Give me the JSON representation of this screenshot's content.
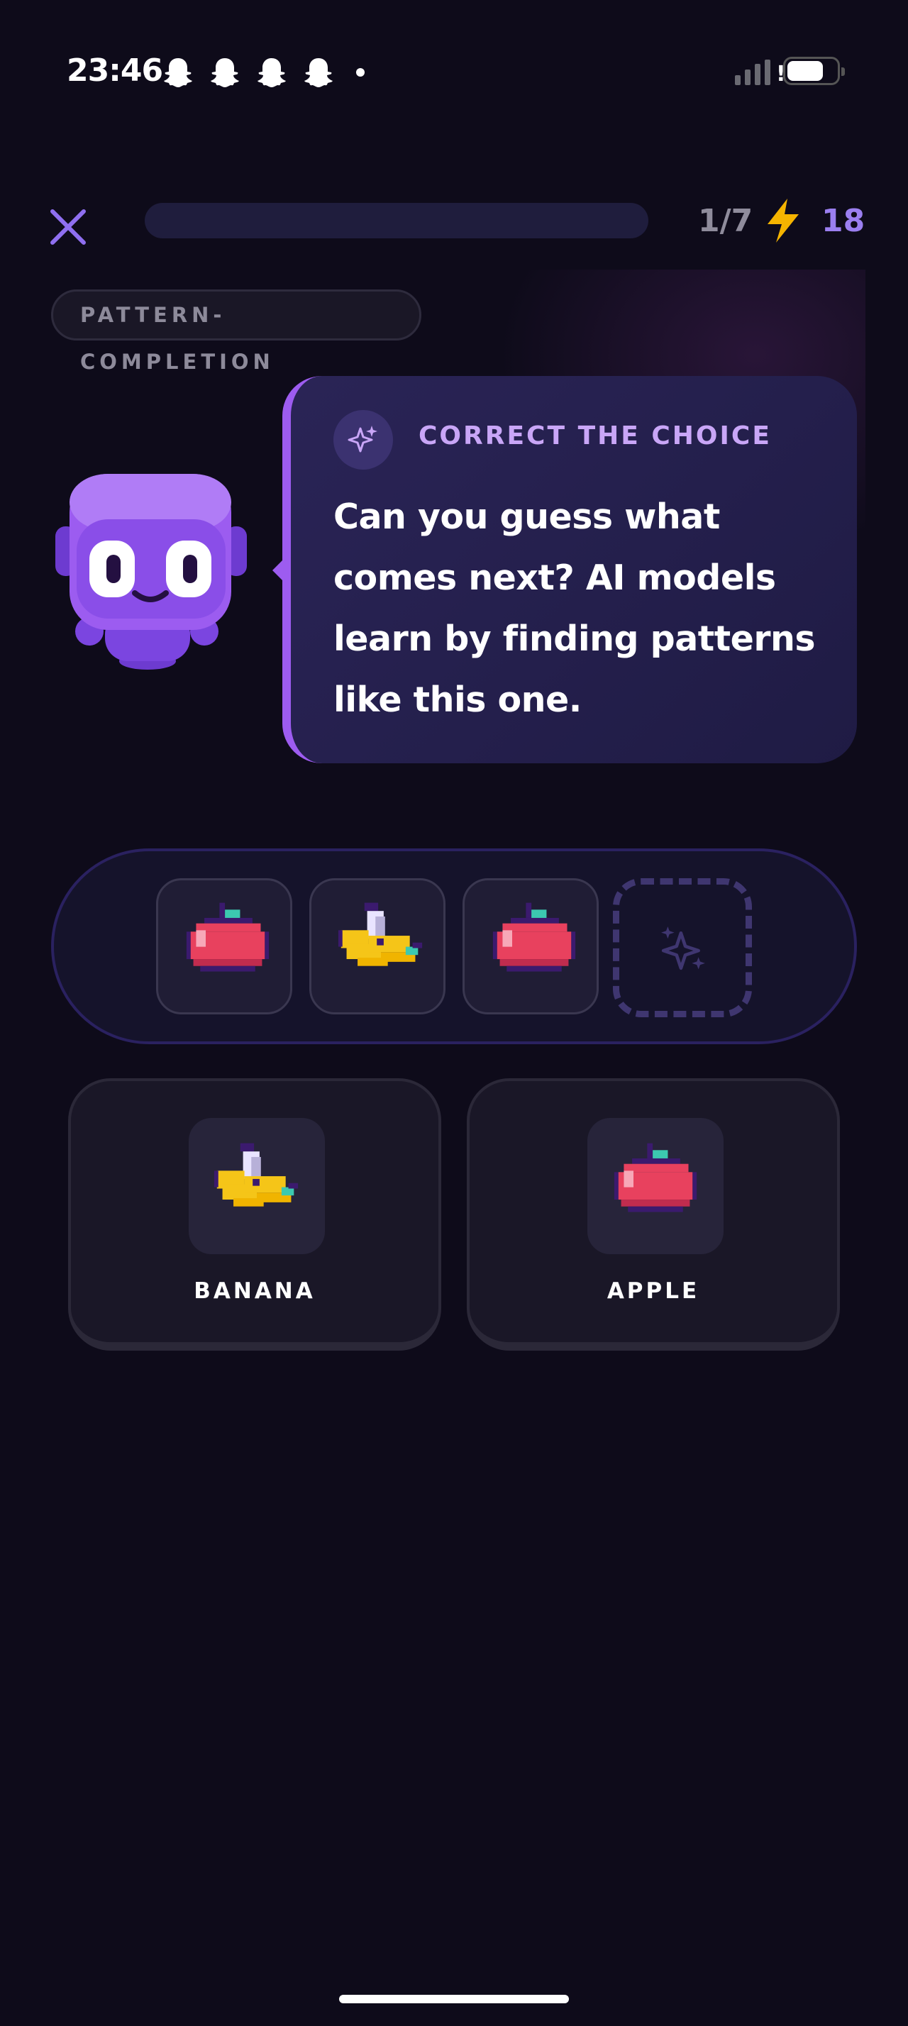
{
  "status_bar": {
    "time": "23:46",
    "notification_icons": [
      "snapchat-ghost-icon",
      "snapchat-ghost-icon",
      "snapchat-ghost-icon",
      "snapchat-ghost-icon"
    ],
    "signal_alert": "!"
  },
  "header": {
    "close_icon": "close-icon",
    "progress": {
      "current": 1,
      "total": 7,
      "fraction": 0.0
    },
    "counter_text": "1/7",
    "xp_icon": "lightning-bolt-icon",
    "xp_value": "18"
  },
  "tag": {
    "label": "PATTERN-COMPLETION"
  },
  "prompt": {
    "icon": "sparkles-icon",
    "title": "CORRECT THE CHOICE",
    "text": "Can you guess what comes next? AI models learn by finding patterns like this one."
  },
  "sequence": {
    "items": [
      "apple",
      "banana",
      "apple"
    ],
    "empty_slot_icon": "sparkles-icon"
  },
  "choices": [
    {
      "label": "BANANA",
      "icon": "banana-icon"
    },
    {
      "label": "APPLE",
      "icon": "apple-icon"
    }
  ],
  "colors": {
    "background": "#0e0b1a",
    "accent": "#9b7ff0",
    "bubble": "#2a2456",
    "bubble_border": "#9d5cf0",
    "bolt": "#f5b400"
  }
}
